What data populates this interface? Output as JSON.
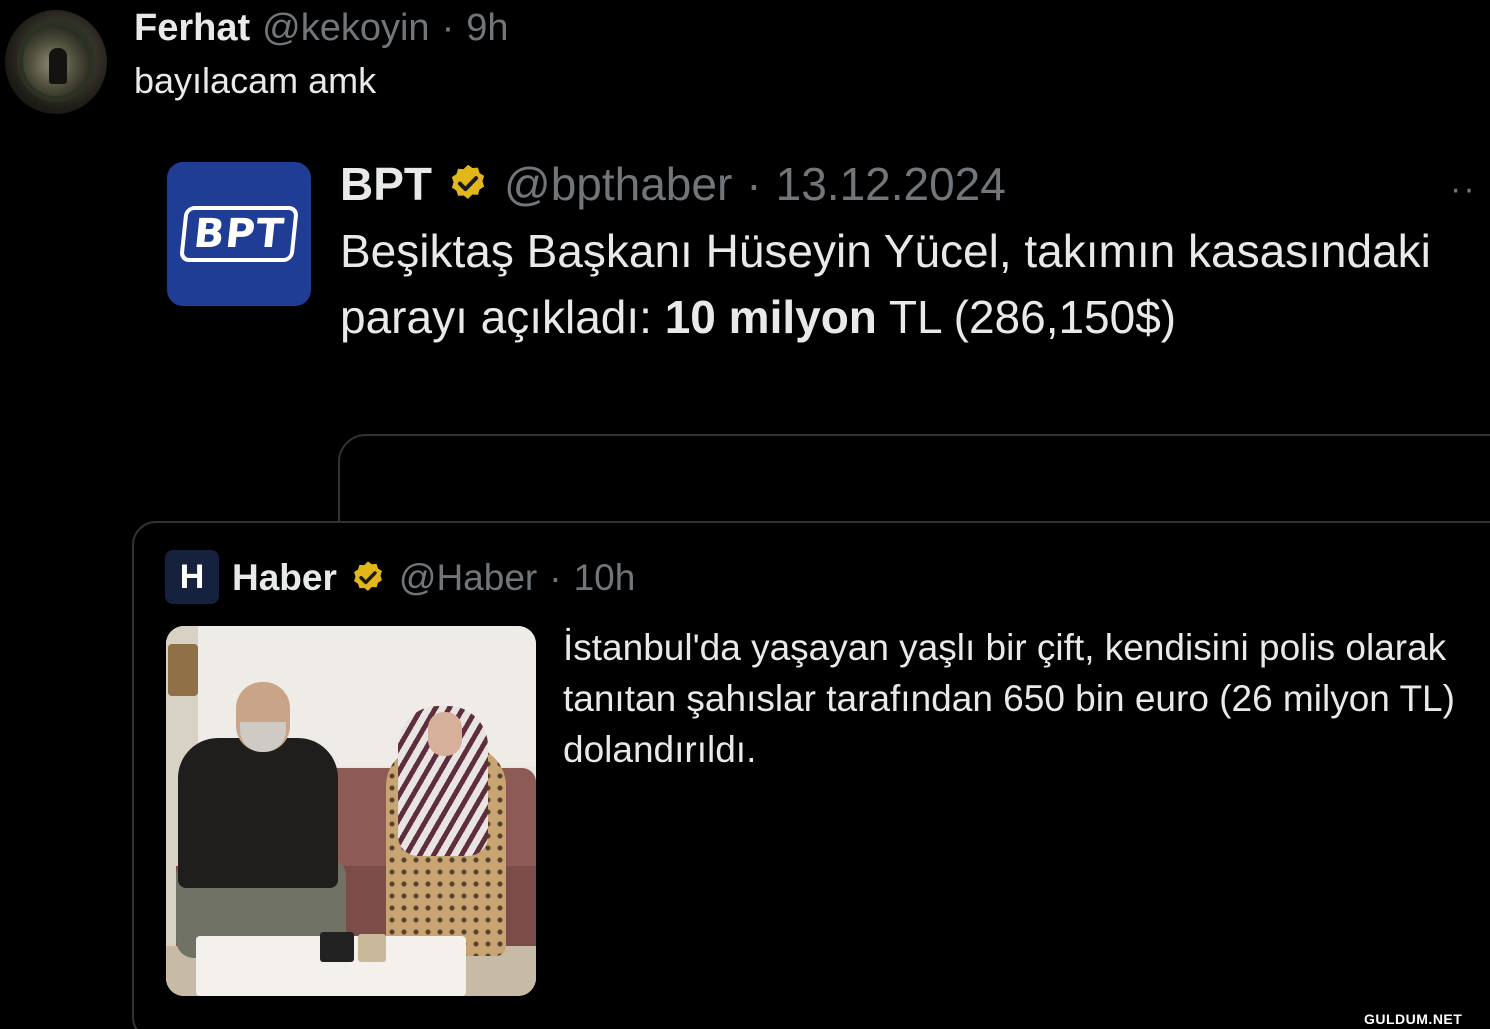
{
  "tweet": {
    "name": "Ferhat",
    "handle": "@kekoyin",
    "separator": "·",
    "time": "9h",
    "text": "bayılacam amk"
  },
  "quoted": {
    "logo_text": "BPT",
    "name": "BPT",
    "handle": "@bpthaber",
    "separator": "·",
    "date": "13.12.2024",
    "more": "··",
    "text_before": "Beşiktaş Başkanı Hüseyin Yücel, takımın kasasındaki parayı açıkladı: ",
    "text_bold": "10 milyon",
    "text_after": " TL (286,150$)"
  },
  "nested": {
    "logo_text": "H",
    "name": "Haber",
    "handle": "@Haber",
    "separator": "·",
    "time": "10h",
    "text": "İstanbul'da yaşayan yaşlı bir çift, kendisini polis olarak tanıtan şahıslar tarafından 650 bin euro (26 milyon TL) dolandırıldı."
  },
  "watermark": "GULDUM.NET",
  "colors": {
    "background": "#000000",
    "text": "#e7e9ea",
    "muted": "#71767b",
    "verified_gold": "#e2b719",
    "border": "#2f3336",
    "bpt_blue": "#1f3d94"
  },
  "icons": [
    "verified-badge-icon",
    "more-icon"
  ]
}
